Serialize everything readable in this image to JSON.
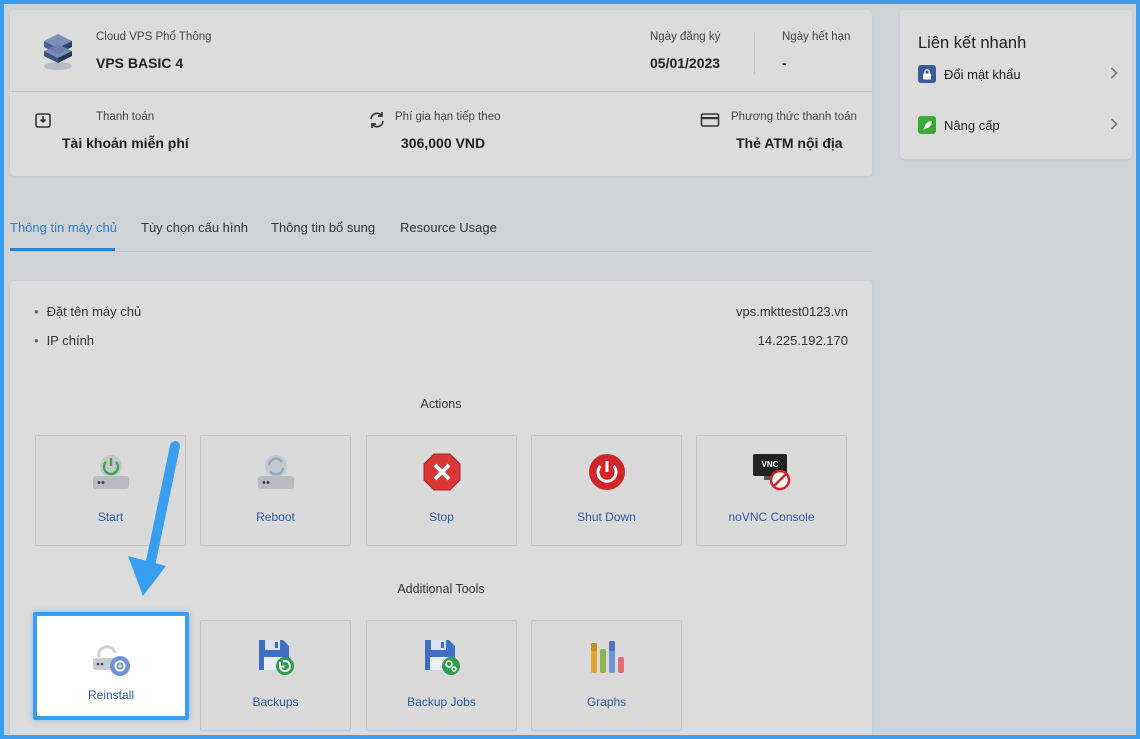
{
  "service": {
    "category": "Cloud VPS Phổ Thông",
    "name": "VPS BASIC 4",
    "reg_date_label": "Ngày đăng ký",
    "reg_date": "05/01/2023",
    "exp_date_label": "Ngày hết hạn",
    "exp_date": "-",
    "billing_label": "Thanh toán",
    "billing_value": "Tài khoản miễn phí",
    "renew_label": "Phí gia hạn tiếp theo",
    "renew_value": "306,000 VND",
    "method_label": "Phương thức thanh toán",
    "method_value": "Thẻ ATM nội địa"
  },
  "quick_links": {
    "title": "Liên kết nhanh",
    "items": [
      {
        "label": "Đổi mật khẩu",
        "icon": "lock-icon",
        "color": "#3d5a99"
      },
      {
        "label": "Nâng cấp",
        "icon": "rocket-icon",
        "color": "#3aaa35"
      }
    ]
  },
  "tabs": [
    {
      "label": "Thông tin máy chủ",
      "active": true
    },
    {
      "label": "Tùy chọn cấu hình",
      "active": false
    },
    {
      "label": "Thông tin bổ sung",
      "active": false
    },
    {
      "label": "Resource Usage",
      "active": false
    }
  ],
  "server_info": [
    {
      "label": "Đặt tên máy chủ",
      "value": "vps.mkttest0123.vn"
    },
    {
      "label": "IP chính",
      "value": "14.225.192.170"
    }
  ],
  "actions": {
    "title": "Actions",
    "items": [
      {
        "label": "Start",
        "icon": "power-drive-icon"
      },
      {
        "label": "Reboot",
        "icon": "reboot-drive-icon"
      },
      {
        "label": "Stop",
        "icon": "stop-icon"
      },
      {
        "label": "Shut Down",
        "icon": "shutdown-icon"
      },
      {
        "label": "noVNC Console",
        "icon": "vnc-console-icon",
        "badge": "VNC"
      }
    ]
  },
  "tools": {
    "title": "Additional Tools",
    "items": [
      {
        "label": "Reinstall",
        "icon": "reinstall-icon",
        "highlighted": true
      },
      {
        "label": "Backups",
        "icon": "backups-icon"
      },
      {
        "label": "Backup Jobs",
        "icon": "backup-jobs-icon"
      },
      {
        "label": "Graphs",
        "icon": "graphs-icon"
      }
    ]
  },
  "colors": {
    "accent": "#2f80c8",
    "highlight": "#3a9ef0",
    "stop_red": "#e03a3a"
  }
}
